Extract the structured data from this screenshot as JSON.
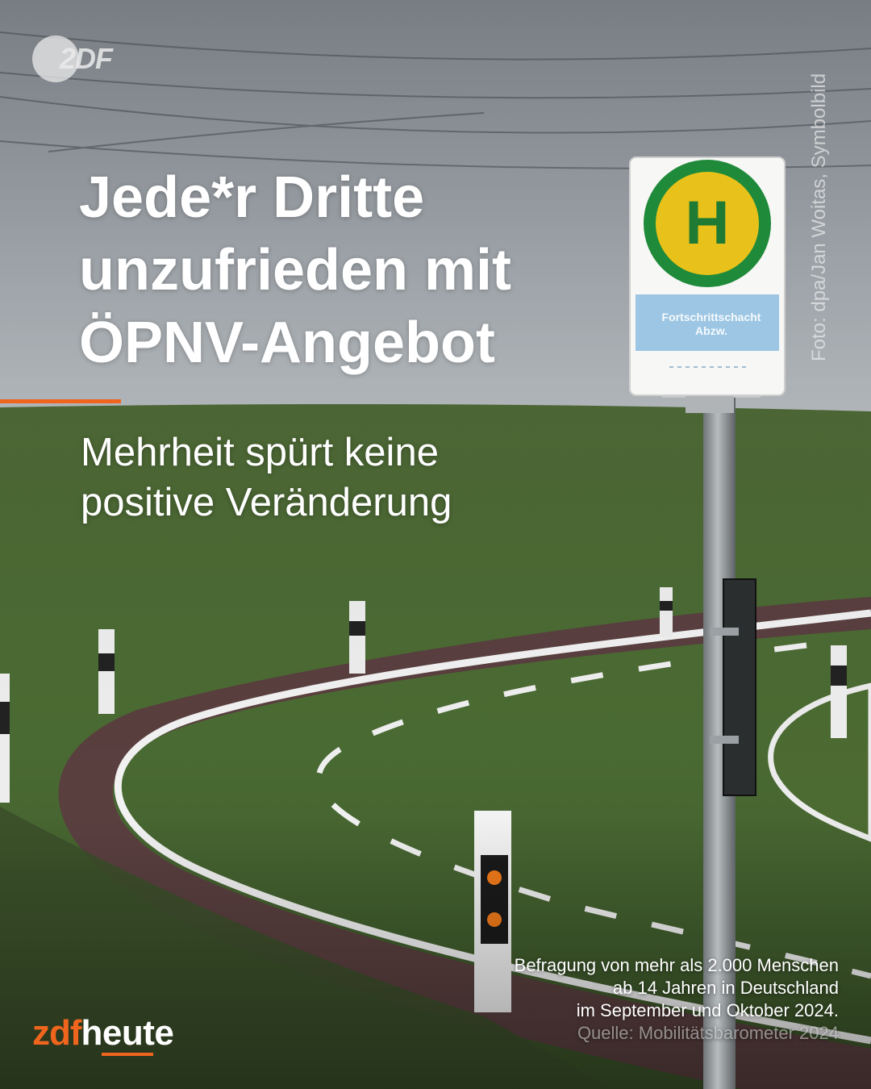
{
  "headline": {
    "line1": "Jede*r Dritte",
    "line2": "unzufrieden mit",
    "line3": "ÖPNV-Angebot"
  },
  "subline": {
    "line1": "Mehrheit spürt keine",
    "line2": "positive Veränderung"
  },
  "photo_credit": "Foto: dpa/Jan Woitas, Symbolbild",
  "source_note": {
    "line1": "Befragung von mehr als 2.000 Menschen",
    "line2": "ab 14 Jahren in Deutschland",
    "line3": "im September und Oktober 2024.",
    "line4": "Quelle: Mobilitätsbarometer 2024"
  },
  "brand": {
    "zdf": "zdf",
    "heute": "heute",
    "top_logo": "2DF"
  },
  "bus_stop_sign": {
    "symbol": "H",
    "stop_name_line1": "Fortschrittschacht",
    "stop_name_line2": "Abzw."
  },
  "colors": {
    "accent": "#f0651e",
    "sign_green": "#1f8a3a",
    "sign_yellow": "#e8c21a"
  }
}
